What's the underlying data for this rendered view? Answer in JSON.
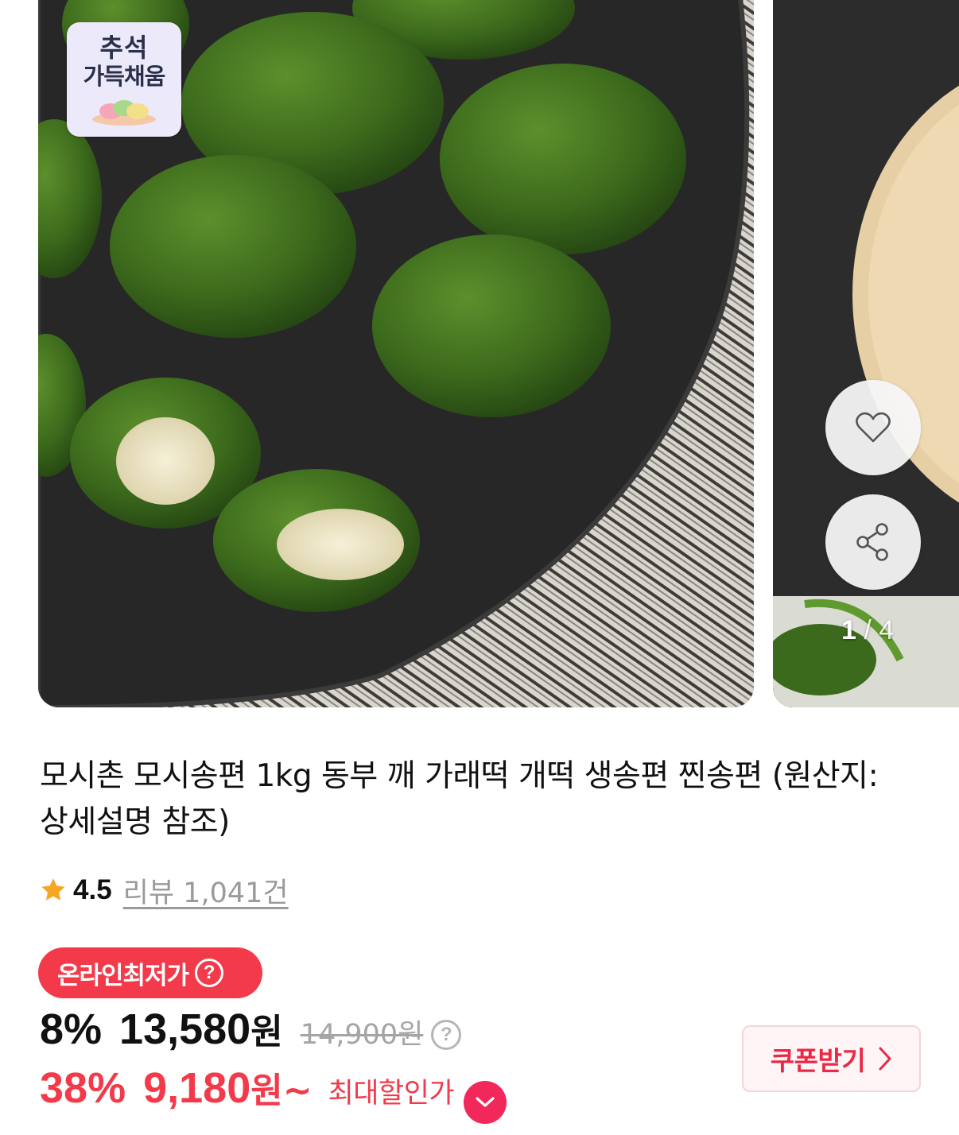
{
  "gallery": {
    "badge_line1": "추석",
    "badge_line2": "가득채움",
    "counter_current": "1",
    "counter_sep": " / ",
    "counter_total": "4"
  },
  "product": {
    "title": "모시촌 모시송편 1kg 동부 깨 가래떡 개떡 생송편 찐송편 (원산지: 상세설명 참조)"
  },
  "rating": {
    "score": "4.5",
    "reviews": "리뷰 1,041건"
  },
  "price": {
    "lowest_badge": "온라인최저가",
    "help_mark": "?",
    "discount_rate": "8%",
    "sale_amount": "13,580",
    "won": "원",
    "original": "14,900원",
    "max_rate": "38%",
    "max_amount": "9,180",
    "max_won": "원~",
    "max_label": "최대할인가"
  },
  "coupon": {
    "label": "쿠폰받기"
  },
  "colors": {
    "accent_red": "#f23a4a",
    "star": "#f5a623",
    "chevron_pink": "#f2285a"
  },
  "icons": [
    "heart-icon",
    "share-icon",
    "star-icon",
    "question-icon",
    "chevron-down-icon",
    "chevron-right-icon"
  ]
}
